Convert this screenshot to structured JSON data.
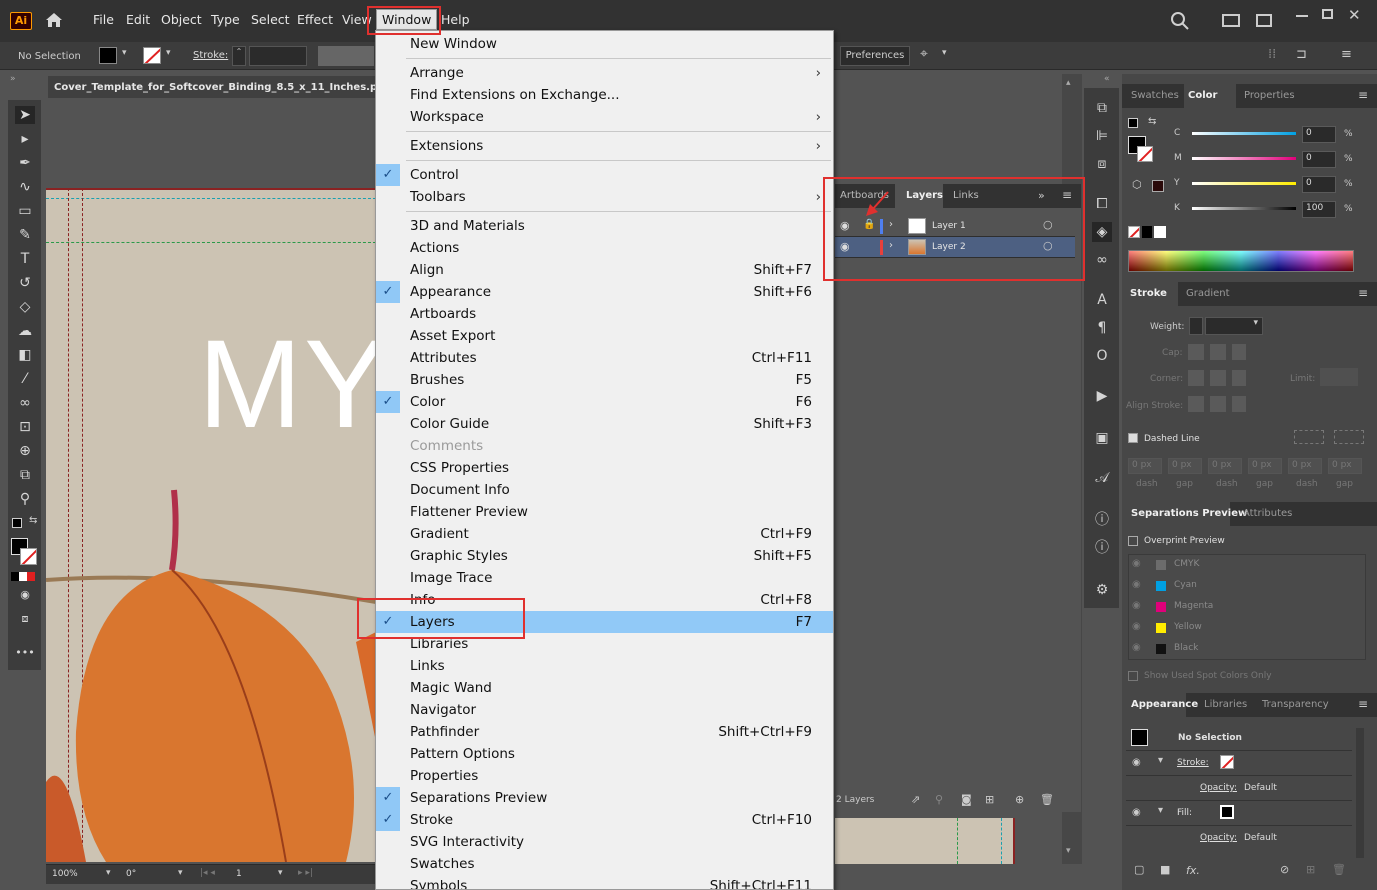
{
  "menubar": {
    "logo": "Ai",
    "items": [
      "File",
      "Edit",
      "Object",
      "Type",
      "Select",
      "Effect",
      "View",
      "Window",
      "Help"
    ]
  },
  "control": {
    "selection": "No Selection",
    "stroke_label": "Stroke:",
    "preferences": "Preferences"
  },
  "document": {
    "tab_title": "Cover_Template_for_Softcover_Binding_8.5_x_11_Inches.pdf*",
    "canvas_text": "MY"
  },
  "status": {
    "zoom": "100%",
    "rotation": "0°",
    "artboard": "1"
  },
  "window_menu": {
    "items": [
      {
        "label": "New Window",
        "shortcut": "",
        "checked": false,
        "submenu": false,
        "disabled": false
      },
      {
        "label": "Arrange",
        "shortcut": "",
        "checked": false,
        "submenu": true,
        "disabled": false
      },
      {
        "label": "Find Extensions on Exchange...",
        "shortcut": "",
        "checked": false,
        "submenu": false,
        "disabled": false
      },
      {
        "label": "Workspace",
        "shortcut": "",
        "checked": false,
        "submenu": true,
        "disabled": false
      },
      {
        "label": "Extensions",
        "shortcut": "",
        "checked": false,
        "submenu": true,
        "disabled": false
      },
      {
        "label": "Control",
        "shortcut": "",
        "checked": true,
        "submenu": false,
        "disabled": false
      },
      {
        "label": "Toolbars",
        "shortcut": "",
        "checked": false,
        "submenu": true,
        "disabled": false
      },
      {
        "label": "3D and Materials",
        "shortcut": "",
        "checked": false,
        "submenu": false,
        "disabled": false
      },
      {
        "label": "Actions",
        "shortcut": "",
        "checked": false,
        "submenu": false,
        "disabled": false
      },
      {
        "label": "Align",
        "shortcut": "Shift+F7",
        "checked": false,
        "submenu": false,
        "disabled": false
      },
      {
        "label": "Appearance",
        "shortcut": "Shift+F6",
        "checked": true,
        "submenu": false,
        "disabled": false
      },
      {
        "label": "Artboards",
        "shortcut": "",
        "checked": false,
        "submenu": false,
        "disabled": false
      },
      {
        "label": "Asset Export",
        "shortcut": "",
        "checked": false,
        "submenu": false,
        "disabled": false
      },
      {
        "label": "Attributes",
        "shortcut": "Ctrl+F11",
        "checked": false,
        "submenu": false,
        "disabled": false
      },
      {
        "label": "Brushes",
        "shortcut": "F5",
        "checked": false,
        "submenu": false,
        "disabled": false
      },
      {
        "label": "Color",
        "shortcut": "F6",
        "checked": true,
        "submenu": false,
        "disabled": false
      },
      {
        "label": "Color Guide",
        "shortcut": "Shift+F3",
        "checked": false,
        "submenu": false,
        "disabled": false
      },
      {
        "label": "Comments",
        "shortcut": "",
        "checked": false,
        "submenu": false,
        "disabled": true
      },
      {
        "label": "CSS Properties",
        "shortcut": "",
        "checked": false,
        "submenu": false,
        "disabled": false
      },
      {
        "label": "Document Info",
        "shortcut": "",
        "checked": false,
        "submenu": false,
        "disabled": false
      },
      {
        "label": "Flattener Preview",
        "shortcut": "",
        "checked": false,
        "submenu": false,
        "disabled": false
      },
      {
        "label": "Gradient",
        "shortcut": "Ctrl+F9",
        "checked": false,
        "submenu": false,
        "disabled": false
      },
      {
        "label": "Graphic Styles",
        "shortcut": "Shift+F5",
        "checked": false,
        "submenu": false,
        "disabled": false
      },
      {
        "label": "Image Trace",
        "shortcut": "",
        "checked": false,
        "submenu": false,
        "disabled": false
      },
      {
        "label": "Info",
        "shortcut": "Ctrl+F8",
        "checked": false,
        "submenu": false,
        "disabled": false
      },
      {
        "label": "Layers",
        "shortcut": "F7",
        "checked": true,
        "submenu": false,
        "disabled": false
      },
      {
        "label": "Libraries",
        "shortcut": "",
        "checked": false,
        "submenu": false,
        "disabled": false
      },
      {
        "label": "Links",
        "shortcut": "",
        "checked": false,
        "submenu": false,
        "disabled": false
      },
      {
        "label": "Magic Wand",
        "shortcut": "",
        "checked": false,
        "submenu": false,
        "disabled": false
      },
      {
        "label": "Navigator",
        "shortcut": "",
        "checked": false,
        "submenu": false,
        "disabled": false
      },
      {
        "label": "Pathfinder",
        "shortcut": "Shift+Ctrl+F9",
        "checked": false,
        "submenu": false,
        "disabled": false
      },
      {
        "label": "Pattern Options",
        "shortcut": "",
        "checked": false,
        "submenu": false,
        "disabled": false
      },
      {
        "label": "Properties",
        "shortcut": "",
        "checked": false,
        "submenu": false,
        "disabled": false
      },
      {
        "label": "Separations Preview",
        "shortcut": "",
        "checked": true,
        "submenu": false,
        "disabled": false
      },
      {
        "label": "Stroke",
        "shortcut": "Ctrl+F10",
        "checked": true,
        "submenu": false,
        "disabled": false
      },
      {
        "label": "SVG Interactivity",
        "shortcut": "",
        "checked": false,
        "submenu": false,
        "disabled": false
      },
      {
        "label": "Swatches",
        "shortcut": "",
        "checked": false,
        "submenu": false,
        "disabled": false
      },
      {
        "label": "Symbols",
        "shortcut": "Shift+Ctrl+F11",
        "checked": false,
        "submenu": false,
        "disabled": false
      }
    ]
  },
  "layers_panel": {
    "tabs": [
      "Artboards",
      "Layers",
      "Links"
    ],
    "layers": [
      {
        "name": "Layer 1",
        "color": "#4f7ff0"
      },
      {
        "name": "Layer 2",
        "color": "#e8403c"
      }
    ],
    "footer": "2 Layers"
  },
  "color_panel": {
    "tabs": [
      "Swatches",
      "Color",
      "Properties"
    ],
    "channels": [
      {
        "label": "C",
        "value": "0"
      },
      {
        "label": "M",
        "value": "0"
      },
      {
        "label": "Y",
        "value": "0"
      },
      {
        "label": "K",
        "value": "100"
      }
    ],
    "unit": "%"
  },
  "stroke_panel": {
    "tabs": [
      "Stroke",
      "Gradient"
    ],
    "weight_label": "Weight:",
    "cap_label": "Cap:",
    "corner_label": "Corner:",
    "limit_label": "Limit:",
    "align_label": "Align Stroke:",
    "dashed_label": "Dashed Line",
    "dash_fields": [
      {
        "value": "0 px",
        "label": "dash"
      },
      {
        "value": "0 px",
        "label": "gap"
      },
      {
        "value": "0 px",
        "label": "dash"
      },
      {
        "value": "0 px",
        "label": "gap"
      },
      {
        "value": "0 px",
        "label": "dash"
      },
      {
        "value": "0 px",
        "label": "gap"
      }
    ]
  },
  "separations_panel": {
    "tabs": [
      "Separations Preview",
      "Attributes"
    ],
    "overprint_label": "Overprint Preview",
    "inks": [
      {
        "name": "CMYK",
        "color": "#6c6c6c"
      },
      {
        "name": "Cyan",
        "color": "#00a0e3"
      },
      {
        "name": "Magenta",
        "color": "#e0007a"
      },
      {
        "name": "Yellow",
        "color": "#ffec00"
      },
      {
        "name": "Black",
        "color": "#111111"
      }
    ],
    "spot_label": "Show Used Spot Colors Only"
  },
  "appearance_panel": {
    "tabs": [
      "Appearance",
      "Libraries",
      "Transparency"
    ],
    "selection": "No Selection",
    "stroke_label": "Stroke:",
    "opacity_label": "Opacity:",
    "opacity_value": "Default",
    "fill_label": "Fill:",
    "opacity2_label": "Opacity:",
    "opacity2_value": "Default",
    "fx_label": "fx."
  }
}
